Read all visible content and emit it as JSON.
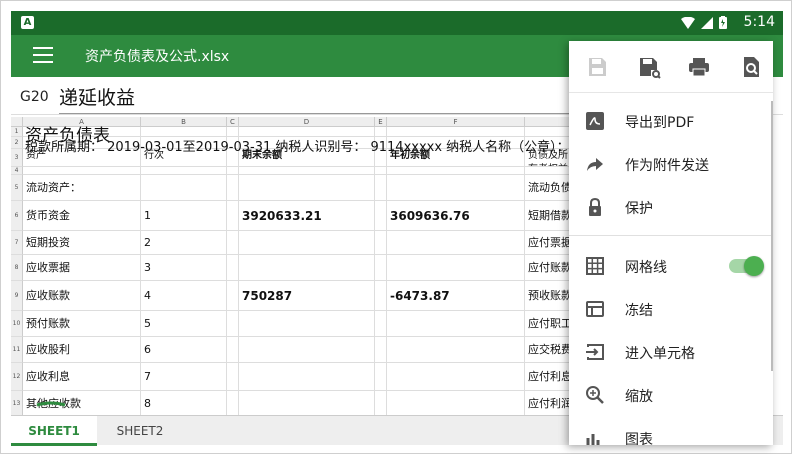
{
  "status": {
    "app_badge": "A",
    "time": "5:14"
  },
  "toolbar": {
    "title": "资产负债表及公式.xlsx"
  },
  "formula_bar": {
    "cell_ref": "G20",
    "content": "递延收益"
  },
  "columns": [
    "A",
    "B",
    "C",
    "D",
    "E",
    "F"
  ],
  "rows": [
    {
      "num": "1",
      "a": "资产负债表",
      "b": "",
      "d": "",
      "f": "",
      "g": ""
    },
    {
      "num": "2",
      "a": "税款所属期：  2019-03-01至2019-03-31 纳税人识别号：  9114xxxxx 纳税人名称（公章）：",
      "b": "",
      "d": "",
      "f": "",
      "g": ""
    },
    {
      "num": "3",
      "a": "资产",
      "b": "行次",
      "d": "期末余额",
      "f": "年初余额",
      "g": "负债及所有者权益"
    },
    {
      "num": "4",
      "a": "",
      "b": "",
      "d": "",
      "f": "",
      "g": ""
    },
    {
      "num": "5",
      "a": "流动资产：",
      "b": "",
      "d": "",
      "f": "",
      "g": "流动负债"
    },
    {
      "num": "6",
      "a": "货币资金",
      "b": "1",
      "d": "3920633.21",
      "f": "3609636.76",
      "g": "短期借款"
    },
    {
      "num": "7",
      "a": "短期投资",
      "b": "2",
      "d": "",
      "f": "",
      "g": "应付票据"
    },
    {
      "num": "8",
      "a": "应收票据",
      "b": "3",
      "d": "",
      "f": "",
      "g": "应付账款"
    },
    {
      "num": "9",
      "a": "应收账款",
      "b": "4",
      "d": "750287",
      "f": "-6473.87",
      "g": "预收账款"
    },
    {
      "num": "10",
      "a": "预付账款",
      "b": "5",
      "d": "",
      "f": "",
      "g": "应付职工"
    },
    {
      "num": "11",
      "a": "应收股利",
      "b": "6",
      "d": "",
      "f": "",
      "g": "应交税费"
    },
    {
      "num": "12",
      "a": "应收利息",
      "b": "7",
      "d": "",
      "f": "",
      "g": "应付利息"
    },
    {
      "num": "13",
      "a": "其他应收款",
      "b": "8",
      "d": "",
      "f": "",
      "g": "应付利润"
    }
  ],
  "menu": {
    "icons": [
      "save-disabled-icon",
      "save-as-icon",
      "print-icon",
      "search-file-icon"
    ],
    "items": [
      {
        "label": "导出到PDF",
        "icon": "pdf-icon"
      },
      {
        "label": "作为附件发送",
        "icon": "share-icon"
      },
      {
        "label": "保护",
        "icon": "lock-icon"
      },
      {
        "label": "网格线",
        "icon": "grid-icon",
        "toggle": true
      },
      {
        "label": "冻结",
        "icon": "freeze-icon"
      },
      {
        "label": "进入单元格",
        "icon": "enter-cell-icon"
      },
      {
        "label": "缩放",
        "icon": "zoom-icon"
      },
      {
        "label": "图表",
        "icon": "chart-icon"
      }
    ]
  },
  "tabs": [
    "SHEET1",
    "SHEET2"
  ],
  "colors": {
    "status_bar": "#1b6b2a",
    "toolbar": "#2e8b3f",
    "accent": "#4caf50"
  }
}
